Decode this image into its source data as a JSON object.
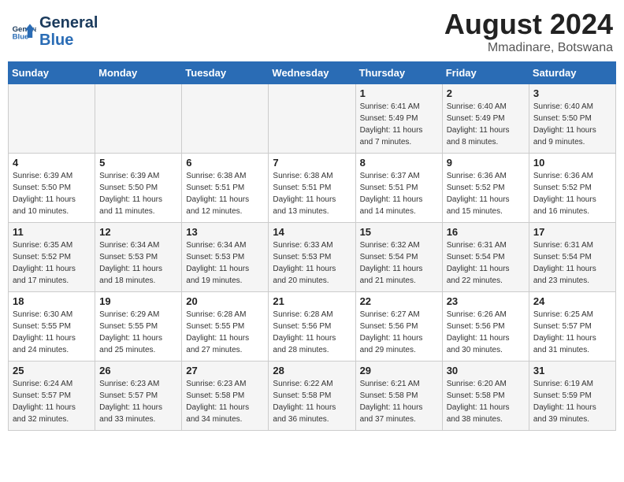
{
  "header": {
    "logo_line1": "General",
    "logo_line2": "Blue",
    "month_year": "August 2024",
    "location": "Mmadinare, Botswana"
  },
  "days_of_week": [
    "Sunday",
    "Monday",
    "Tuesday",
    "Wednesday",
    "Thursday",
    "Friday",
    "Saturday"
  ],
  "weeks": [
    [
      {
        "day": "",
        "info": ""
      },
      {
        "day": "",
        "info": ""
      },
      {
        "day": "",
        "info": ""
      },
      {
        "day": "",
        "info": ""
      },
      {
        "day": "1",
        "info": "Sunrise: 6:41 AM\nSunset: 5:49 PM\nDaylight: 11 hours\nand 7 minutes."
      },
      {
        "day": "2",
        "info": "Sunrise: 6:40 AM\nSunset: 5:49 PM\nDaylight: 11 hours\nand 8 minutes."
      },
      {
        "day": "3",
        "info": "Sunrise: 6:40 AM\nSunset: 5:50 PM\nDaylight: 11 hours\nand 9 minutes."
      }
    ],
    [
      {
        "day": "4",
        "info": "Sunrise: 6:39 AM\nSunset: 5:50 PM\nDaylight: 11 hours\nand 10 minutes."
      },
      {
        "day": "5",
        "info": "Sunrise: 6:39 AM\nSunset: 5:50 PM\nDaylight: 11 hours\nand 11 minutes."
      },
      {
        "day": "6",
        "info": "Sunrise: 6:38 AM\nSunset: 5:51 PM\nDaylight: 11 hours\nand 12 minutes."
      },
      {
        "day": "7",
        "info": "Sunrise: 6:38 AM\nSunset: 5:51 PM\nDaylight: 11 hours\nand 13 minutes."
      },
      {
        "day": "8",
        "info": "Sunrise: 6:37 AM\nSunset: 5:51 PM\nDaylight: 11 hours\nand 14 minutes."
      },
      {
        "day": "9",
        "info": "Sunrise: 6:36 AM\nSunset: 5:52 PM\nDaylight: 11 hours\nand 15 minutes."
      },
      {
        "day": "10",
        "info": "Sunrise: 6:36 AM\nSunset: 5:52 PM\nDaylight: 11 hours\nand 16 minutes."
      }
    ],
    [
      {
        "day": "11",
        "info": "Sunrise: 6:35 AM\nSunset: 5:52 PM\nDaylight: 11 hours\nand 17 minutes."
      },
      {
        "day": "12",
        "info": "Sunrise: 6:34 AM\nSunset: 5:53 PM\nDaylight: 11 hours\nand 18 minutes."
      },
      {
        "day": "13",
        "info": "Sunrise: 6:34 AM\nSunset: 5:53 PM\nDaylight: 11 hours\nand 19 minutes."
      },
      {
        "day": "14",
        "info": "Sunrise: 6:33 AM\nSunset: 5:53 PM\nDaylight: 11 hours\nand 20 minutes."
      },
      {
        "day": "15",
        "info": "Sunrise: 6:32 AM\nSunset: 5:54 PM\nDaylight: 11 hours\nand 21 minutes."
      },
      {
        "day": "16",
        "info": "Sunrise: 6:31 AM\nSunset: 5:54 PM\nDaylight: 11 hours\nand 22 minutes."
      },
      {
        "day": "17",
        "info": "Sunrise: 6:31 AM\nSunset: 5:54 PM\nDaylight: 11 hours\nand 23 minutes."
      }
    ],
    [
      {
        "day": "18",
        "info": "Sunrise: 6:30 AM\nSunset: 5:55 PM\nDaylight: 11 hours\nand 24 minutes."
      },
      {
        "day": "19",
        "info": "Sunrise: 6:29 AM\nSunset: 5:55 PM\nDaylight: 11 hours\nand 25 minutes."
      },
      {
        "day": "20",
        "info": "Sunrise: 6:28 AM\nSunset: 5:55 PM\nDaylight: 11 hours\nand 27 minutes."
      },
      {
        "day": "21",
        "info": "Sunrise: 6:28 AM\nSunset: 5:56 PM\nDaylight: 11 hours\nand 28 minutes."
      },
      {
        "day": "22",
        "info": "Sunrise: 6:27 AM\nSunset: 5:56 PM\nDaylight: 11 hours\nand 29 minutes."
      },
      {
        "day": "23",
        "info": "Sunrise: 6:26 AM\nSunset: 5:56 PM\nDaylight: 11 hours\nand 30 minutes."
      },
      {
        "day": "24",
        "info": "Sunrise: 6:25 AM\nSunset: 5:57 PM\nDaylight: 11 hours\nand 31 minutes."
      }
    ],
    [
      {
        "day": "25",
        "info": "Sunrise: 6:24 AM\nSunset: 5:57 PM\nDaylight: 11 hours\nand 32 minutes."
      },
      {
        "day": "26",
        "info": "Sunrise: 6:23 AM\nSunset: 5:57 PM\nDaylight: 11 hours\nand 33 minutes."
      },
      {
        "day": "27",
        "info": "Sunrise: 6:23 AM\nSunset: 5:58 PM\nDaylight: 11 hours\nand 34 minutes."
      },
      {
        "day": "28",
        "info": "Sunrise: 6:22 AM\nSunset: 5:58 PM\nDaylight: 11 hours\nand 36 minutes."
      },
      {
        "day": "29",
        "info": "Sunrise: 6:21 AM\nSunset: 5:58 PM\nDaylight: 11 hours\nand 37 minutes."
      },
      {
        "day": "30",
        "info": "Sunrise: 6:20 AM\nSunset: 5:58 PM\nDaylight: 11 hours\nand 38 minutes."
      },
      {
        "day": "31",
        "info": "Sunrise: 6:19 AM\nSunset: 5:59 PM\nDaylight: 11 hours\nand 39 minutes."
      }
    ]
  ]
}
